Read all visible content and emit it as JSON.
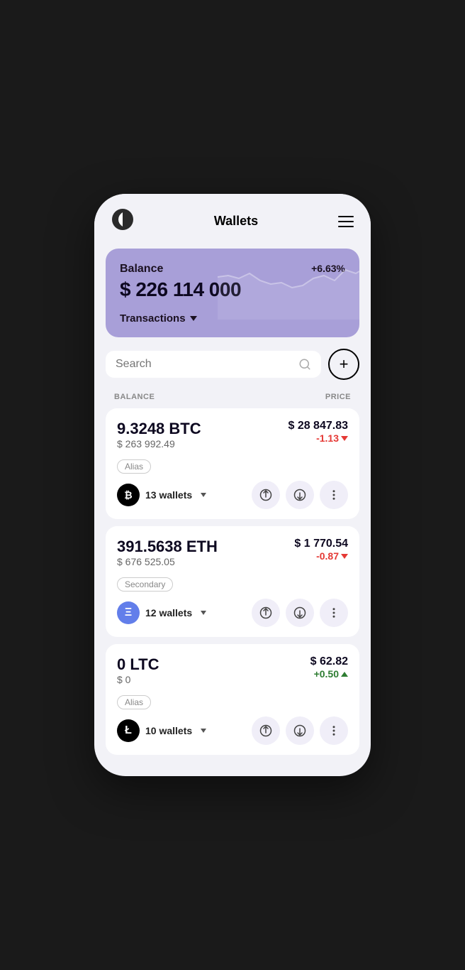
{
  "header": {
    "title": "Wallets",
    "menu_label": "menu"
  },
  "balance_card": {
    "label": "Balance",
    "percent": "+6.63%",
    "amount": "$ 226 114 000",
    "transactions_label": "Transactions"
  },
  "search": {
    "placeholder": "Search",
    "add_label": "+"
  },
  "columns": {
    "balance": "BALANCE",
    "price": "PRICE"
  },
  "cryptos": [
    {
      "id": "btc",
      "amount": "9.3248 BTC",
      "usd_value": "$ 263 992.49",
      "price": "$ 28 847.83",
      "change": "-1.13",
      "change_type": "negative",
      "alias": "Alias",
      "wallets": "13 wallets",
      "symbol": "₿",
      "icon_bg": "#000000"
    },
    {
      "id": "eth",
      "amount": "391.5638 ETH",
      "usd_value": "$ 676 525.05",
      "price": "$ 1 770.54",
      "change": "-0.87",
      "change_type": "negative",
      "alias": "Secondary",
      "wallets": "12 wallets",
      "symbol": "Ξ",
      "icon_bg": "#627eea"
    },
    {
      "id": "ltc",
      "amount": "0 LTC",
      "usd_value": "$ 0",
      "price": "$ 62.82",
      "change": "+0.50",
      "change_type": "positive",
      "alias": "Alias",
      "wallets": "10 wallets",
      "symbol": "Ł",
      "icon_bg": "#000000"
    }
  ],
  "actions": {
    "send_label": "send",
    "receive_label": "receive",
    "more_label": "more"
  }
}
